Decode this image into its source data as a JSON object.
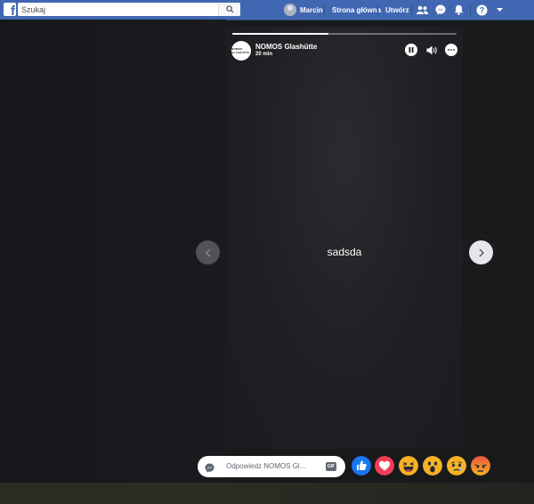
{
  "topbar": {
    "search_placeholder": "Szukaj",
    "user_name": "Marcin",
    "home_label": "Strona główna",
    "create_label": "Utwórz",
    "brand_color": "#4267b2"
  },
  "story": {
    "page_name": "NOMOS Glashütte",
    "posted_ago": "20 min",
    "avatar_text": "NOMOS GLASHÜTTE",
    "content_text": "sadsda",
    "progress_fraction": 0.43
  },
  "reply": {
    "placeholder": "Odpowiedz NOMOS Gl...",
    "gif_label": "GIF"
  },
  "reactions": [
    "like",
    "love",
    "haha",
    "wow",
    "sad",
    "angry"
  ]
}
